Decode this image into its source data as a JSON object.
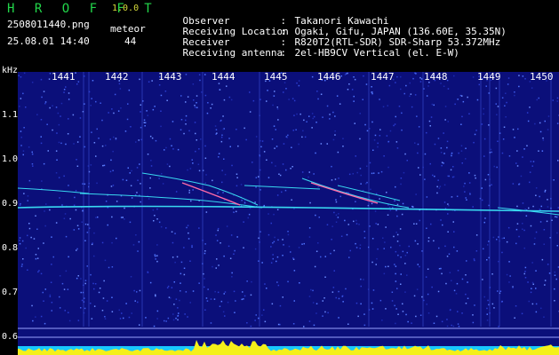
{
  "header": {
    "app_title": "H R O F F T",
    "app_version": "1.0.0",
    "file_name": "2508011440.png",
    "meteor_label": "meteor",
    "date_time": "25.08.01 14:40",
    "meteor_count": "44",
    "info": [
      {
        "key": "Observer",
        "value": "Takanori Kawachi"
      },
      {
        "key": "Receiving Location",
        "value": "Ogaki, Gifu, JAPAN (136.60E, 35.35N)"
      },
      {
        "key": "Receiver",
        "value": "R820T2(RTL-SDR) SDR-Sharp 53.372MHz"
      },
      {
        "key": "Receiving antenna",
        "value": "2el-HB9CV Vertical (el. E-W)"
      }
    ],
    "colon": ":"
  },
  "axes": {
    "y_unit": "kHz",
    "time_ticks": [
      "1441",
      "1442",
      "1443",
      "1444",
      "1445",
      "1446",
      "1447",
      "1448",
      "1449",
      "1450"
    ],
    "freq_ticks": [
      "1.1",
      "1.0",
      "0.9",
      "0.8",
      "0.7",
      "0.6"
    ]
  },
  "colors": {
    "background": "#000000",
    "spectrogram_bg": "#0b0f7a",
    "trace": "#39d8f0",
    "meteor_head": "#ff6aa8",
    "level_fill": "#f4f01a",
    "level_base": "#18c8ff",
    "app_title": "#22d64a"
  }
}
